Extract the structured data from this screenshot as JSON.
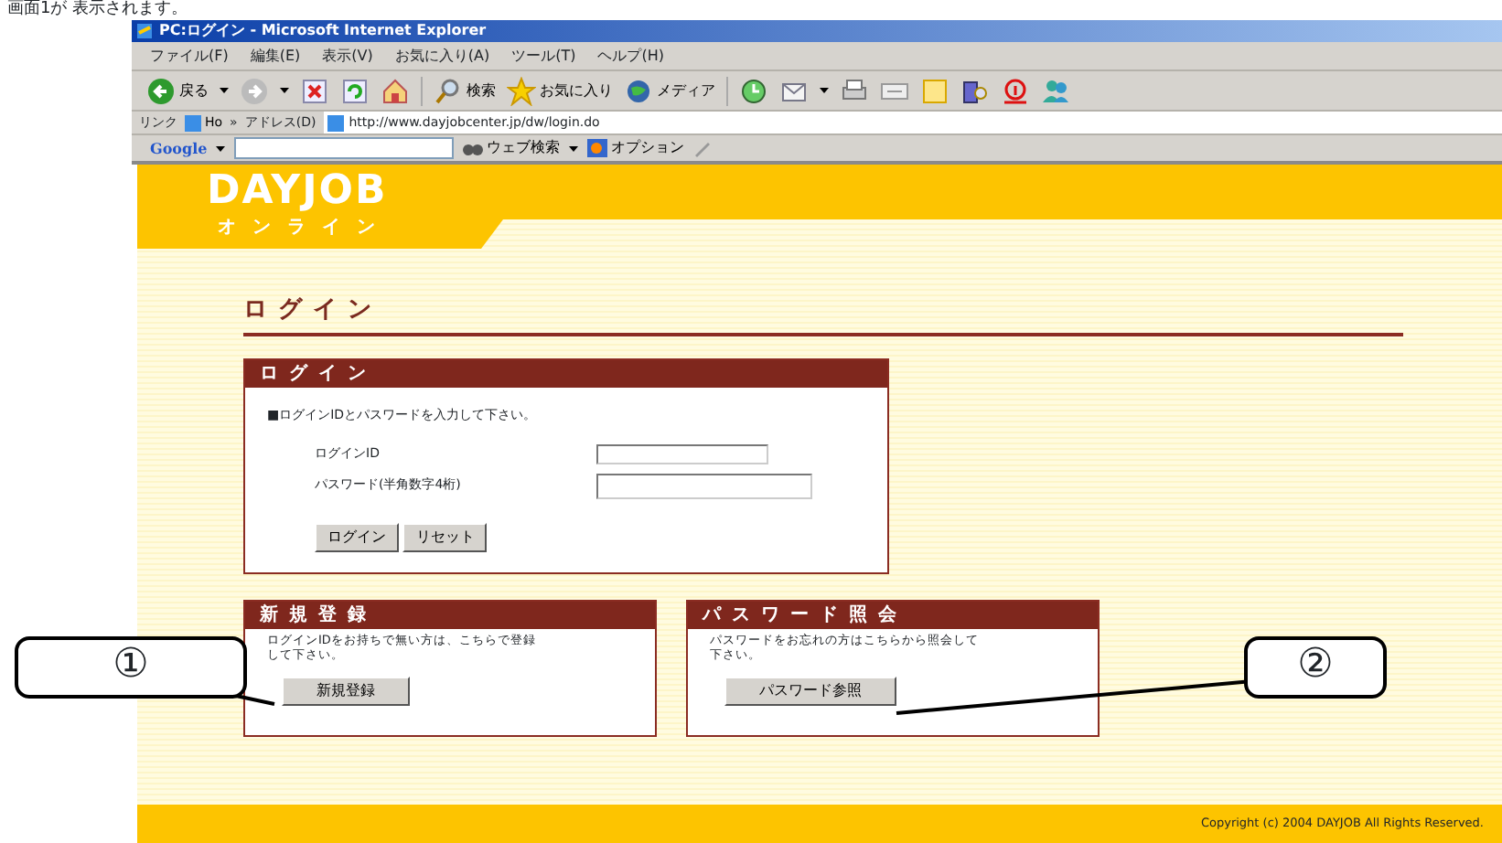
{
  "document_text": "画面1が 表示されます。",
  "window": {
    "title": "PC:ログイン - Microsoft Internet Explorer"
  },
  "menu": [
    "ファイル(F)",
    "編集(E)",
    "表示(V)",
    "お気に入り(A)",
    "ツール(T)",
    "ヘルプ(H)"
  ],
  "toolbar": [
    {
      "kind": "labeled",
      "label": "戻る",
      "dropdown": true
    },
    {
      "kind": "icon",
      "dropdown": true
    },
    {
      "kind": "icon"
    },
    {
      "kind": "icon"
    },
    {
      "kind": "icon"
    },
    {
      "kind": "labeled",
      "label": "検索"
    },
    {
      "kind": "labeled",
      "label": "お気に入り"
    },
    {
      "kind": "labeled",
      "label": "メディア"
    },
    {
      "kind": "icon"
    },
    {
      "kind": "icon",
      "dropdown": true
    },
    {
      "kind": "icon"
    },
    {
      "kind": "icon"
    },
    {
      "kind": "icon"
    },
    {
      "kind": "icon"
    },
    {
      "kind": "icon"
    },
    {
      "kind": "icon"
    }
  ],
  "links_bar": {
    "label": "リンク",
    "item": "Ho",
    "more": "»",
    "address_label": "アドレス(D)",
    "url": "http://www.dayjobcenter.jp/dw/login.do"
  },
  "google_bar": {
    "logo": "Google",
    "search_label": "ウェブ検索",
    "options_label": "オプション"
  },
  "page": {
    "logo": "DAYJOB",
    "logo_sub": "オンライン",
    "heading": "ログイン",
    "login_panel": {
      "title": "ログイン",
      "instruction": "■ログインIDとパスワードを入力して下さい。",
      "fields": [
        {
          "label": "ログインID"
        },
        {
          "label": "パスワード(半角数字4桁)"
        }
      ],
      "buttons": [
        "ログイン",
        "リセット"
      ]
    },
    "panels": [
      {
        "title": "新規登録",
        "text": "ログインIDをお持ちで無い方は、こちらで登録して下さい。",
        "button": "新規登録"
      },
      {
        "title": "パスワード照会",
        "text": "パスワードをお忘れの方はこちらから照会して下さい。",
        "button": "パスワード参照"
      }
    ],
    "footer": "Copyright (c) 2004 DAYJOB All Rights Reserved."
  },
  "callouts": [
    "①",
    "②"
  ]
}
